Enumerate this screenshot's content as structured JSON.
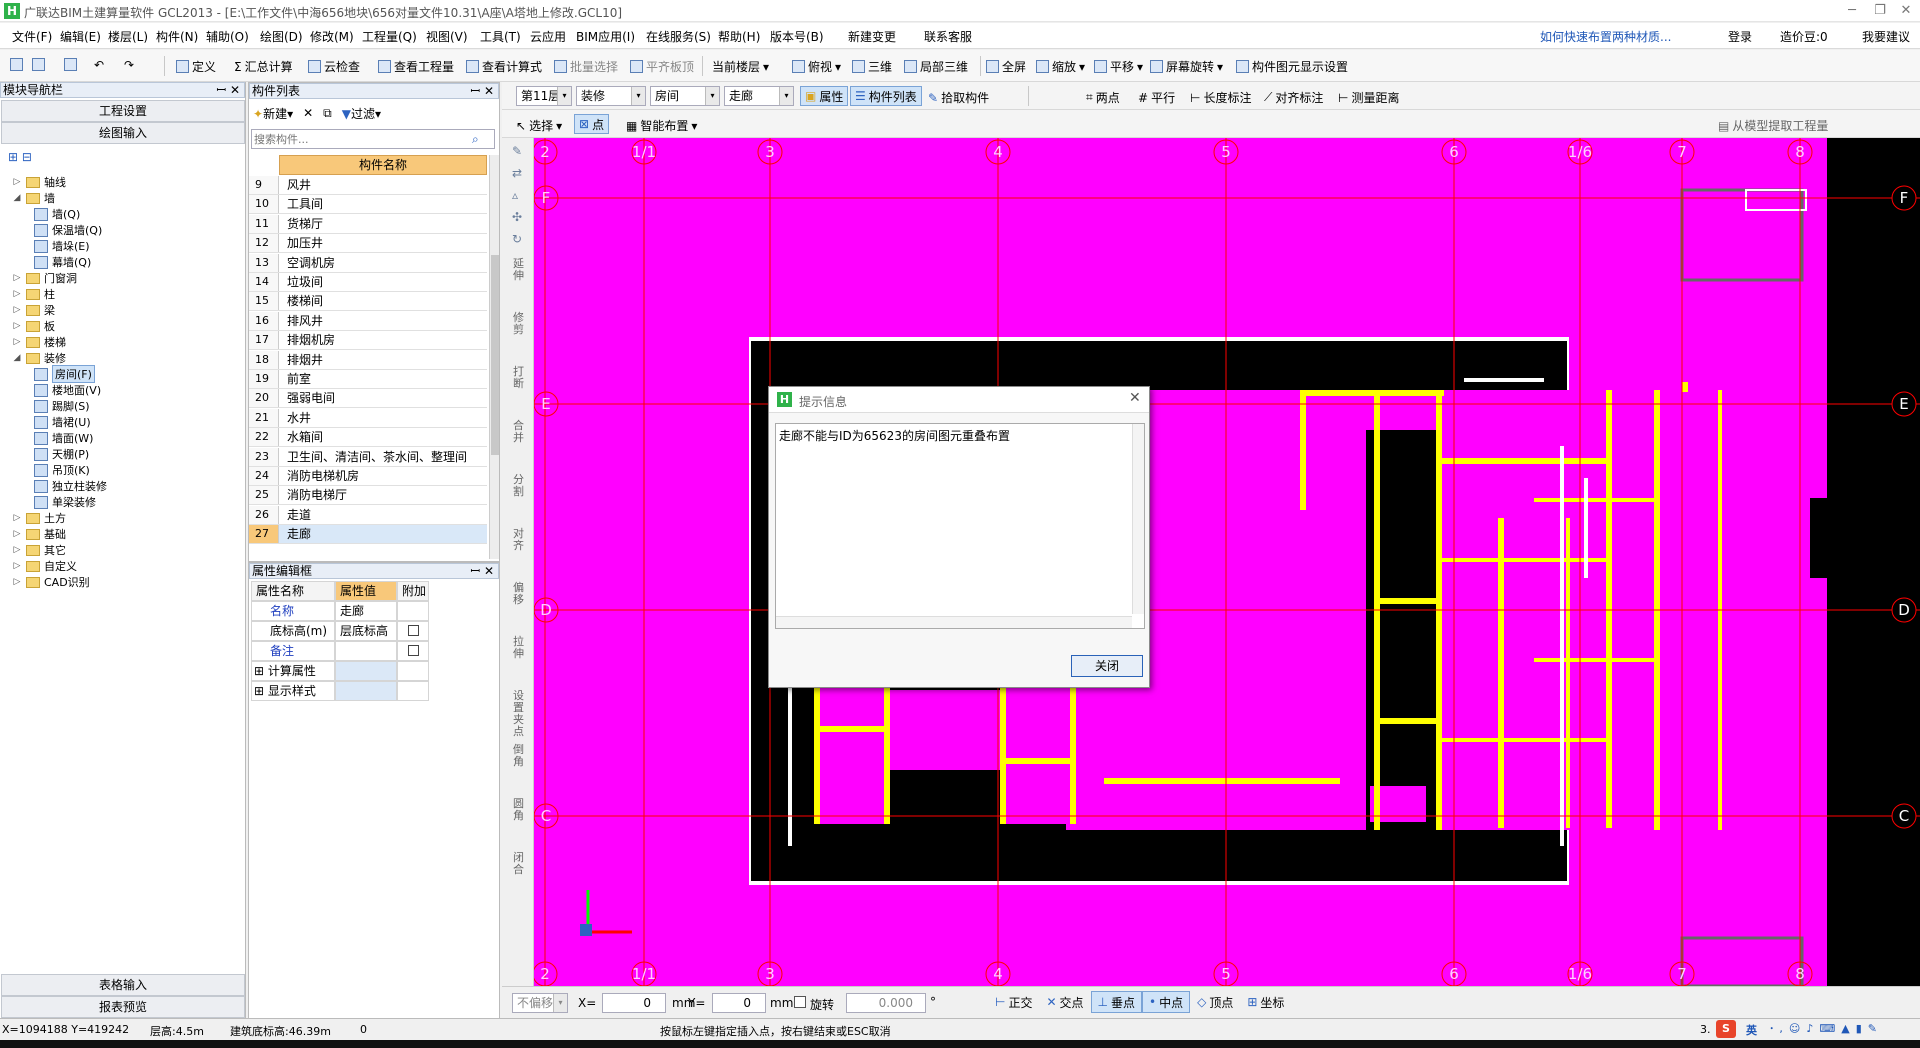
{
  "app": {
    "title": "广联达BIM土建算量软件 GCL2013 - [E:\\工作文件\\中海656地块\\656对量文件10.31\\A座\\A塔地上修改.GCL10]",
    "logo": "H"
  },
  "menu": [
    "文件(F)",
    "编辑(E)",
    "楼层(L)",
    "构件(N)",
    "辅助(O)",
    "绘图(D)",
    "修改(M)",
    "工程量(Q)",
    "视图(V)",
    "工具(T)",
    "云应用",
    "BIM应用(I)",
    "在线服务(S)",
    "帮助(H)",
    "版本号(B)",
    "新建变更",
    "联系客服"
  ],
  "menu_right": {
    "tip": "如何快速布置两种材质...",
    "login": "登录",
    "cost": "造价豆:0",
    "feedback": "我要建议"
  },
  "toolbar1": [
    "定义",
    "汇总计算",
    "云检查",
    "查看工程量",
    "查看计算式",
    "批量选择",
    "平齐板顶",
    "当前楼层",
    "俯视",
    "三维",
    "局部三维",
    "全屏",
    "缩放",
    "平移",
    "屏幕旋转",
    "构件图元显示设置"
  ],
  "nav": {
    "title": "模块导航栏",
    "btn_project": "工程设置",
    "btn_draw": "绘图输入",
    "btn_table": "表格输入",
    "btn_report": "报表预览",
    "tree": [
      {
        "label": "轴线",
        "level": 0,
        "expand": "▷"
      },
      {
        "label": "墙",
        "level": 0,
        "expand": "◢"
      },
      {
        "label": "墙(Q)",
        "level": 1
      },
      {
        "label": "保温墙(Q)",
        "level": 1
      },
      {
        "label": "墙垛(E)",
        "level": 1
      },
      {
        "label": "幕墙(Q)",
        "level": 1
      },
      {
        "label": "门窗洞",
        "level": 0,
        "expand": "▷"
      },
      {
        "label": "柱",
        "level": 0,
        "expand": "▷"
      },
      {
        "label": "梁",
        "level": 0,
        "expand": "▷"
      },
      {
        "label": "板",
        "level": 0,
        "expand": "▷"
      },
      {
        "label": "楼梯",
        "level": 0,
        "expand": "▷"
      },
      {
        "label": "装修",
        "level": 0,
        "expand": "◢"
      },
      {
        "label": "房间(F)",
        "level": 1,
        "selected": true
      },
      {
        "label": "楼地面(V)",
        "level": 1
      },
      {
        "label": "踢脚(S)",
        "level": 1
      },
      {
        "label": "墙裙(U)",
        "level": 1
      },
      {
        "label": "墙面(W)",
        "level": 1
      },
      {
        "label": "天棚(P)",
        "level": 1
      },
      {
        "label": "吊顶(K)",
        "level": 1
      },
      {
        "label": "独立柱装修",
        "level": 1
      },
      {
        "label": "单梁装修",
        "level": 1
      },
      {
        "label": "土方",
        "level": 0,
        "expand": "▷"
      },
      {
        "label": "基础",
        "level": 0,
        "expand": "▷"
      },
      {
        "label": "其它",
        "level": 0,
        "expand": "▷"
      },
      {
        "label": "自定义",
        "level": 0,
        "expand": "▷"
      },
      {
        "label": "CAD识别",
        "level": 0,
        "expand": "▷"
      }
    ]
  },
  "complist": {
    "title": "构件列表",
    "new": "新建",
    "filter": "过滤",
    "search_placeholder": "搜索构件...",
    "col_header": "构件名称",
    "rows": [
      {
        "n": "9",
        "name": "风井"
      },
      {
        "n": "10",
        "name": "工具间"
      },
      {
        "n": "11",
        "name": "货梯厅"
      },
      {
        "n": "12",
        "name": "加压井"
      },
      {
        "n": "13",
        "name": "空调机房"
      },
      {
        "n": "14",
        "name": "垃圾间"
      },
      {
        "n": "15",
        "name": "楼梯间"
      },
      {
        "n": "16",
        "name": "排风井"
      },
      {
        "n": "17",
        "name": "排烟机房"
      },
      {
        "n": "18",
        "name": "排烟井"
      },
      {
        "n": "19",
        "name": "前室"
      },
      {
        "n": "20",
        "name": "强弱电间"
      },
      {
        "n": "21",
        "name": "水井"
      },
      {
        "n": "22",
        "name": "水箱间"
      },
      {
        "n": "23",
        "name": "卫生间、清洁间、茶水间、整理间"
      },
      {
        "n": "24",
        "name": "消防电梯机房"
      },
      {
        "n": "25",
        "name": "消防电梯厅"
      },
      {
        "n": "26",
        "name": "走道"
      },
      {
        "n": "27",
        "name": "走廊"
      }
    ]
  },
  "props": {
    "title": "属性编辑框",
    "h_name": "属性名称",
    "h_value": "属性值",
    "h_extra": "附加",
    "rows": [
      {
        "name": "名称",
        "value": "走廊",
        "blue": true,
        "check": false
      },
      {
        "name": "底标高(m)",
        "value": "层底标高",
        "blue": false,
        "check": true
      },
      {
        "name": "备注",
        "value": "",
        "blue": true,
        "check": true
      },
      {
        "name": "计算属性",
        "value": "",
        "group": true
      },
      {
        "name": "显示样式",
        "value": "",
        "group": true
      }
    ]
  },
  "toolbar2": {
    "floor": "第11层",
    "type": "装修",
    "cat": "房间",
    "item": "走廊",
    "attr": "属性",
    "list": "构件列表",
    "pick": "拾取构件",
    "two_pts": "两点",
    "parallel": "平行",
    "len_mark": "长度标注",
    "align_mark": "对齐标注",
    "measure": "测量距离"
  },
  "toolbar3": {
    "select": "选择",
    "point": "点",
    "smart": "智能布置",
    "extract": "从模型提取工程量"
  },
  "lefttools": [
    "延伸",
    "修剪",
    "打断",
    "合并",
    "分割",
    "对齐",
    "偏移",
    "拉伸",
    "设置夹点",
    "倒角",
    "圆角",
    "闭合"
  ],
  "canvas": {
    "axis_top": [
      "2",
      "1/1",
      "3",
      "4",
      "5",
      "6",
      "1/6",
      "7",
      "8"
    ],
    "axis_side": [
      "F",
      "E",
      "D",
      "C"
    ],
    "colors": {
      "room": "#ff00ff",
      "wall": "#ffff00",
      "grid": "#ff0000",
      "bg": "#000000",
      "white": "#ffffff"
    }
  },
  "dialog": {
    "title": "提示信息",
    "message": "走廊不能与ID为65623的房间图元重叠布置",
    "close": "关闭"
  },
  "bottombar": {
    "offset": "不偏移",
    "x_label": "X=",
    "x_val": "0",
    "mm1": "mm",
    "y_label": "Y=",
    "y_val": "0",
    "mm2": "mm",
    "rotate": "旋转",
    "rot_val": "0.000",
    "deg": "°",
    "snaps": [
      "正交",
      "交点",
      "垂点",
      "中点",
      "顶点",
      "坐标"
    ]
  },
  "status": {
    "coords": "X=1094188 Y=419242",
    "floor_h": "层高:4.5m",
    "base_h": "建筑底标高:46.39m",
    "zero": "0",
    "hint": "按鼠标左键指定插入点，按右键结束或ESC取消",
    "right_num": "3.",
    "ime": "英"
  }
}
